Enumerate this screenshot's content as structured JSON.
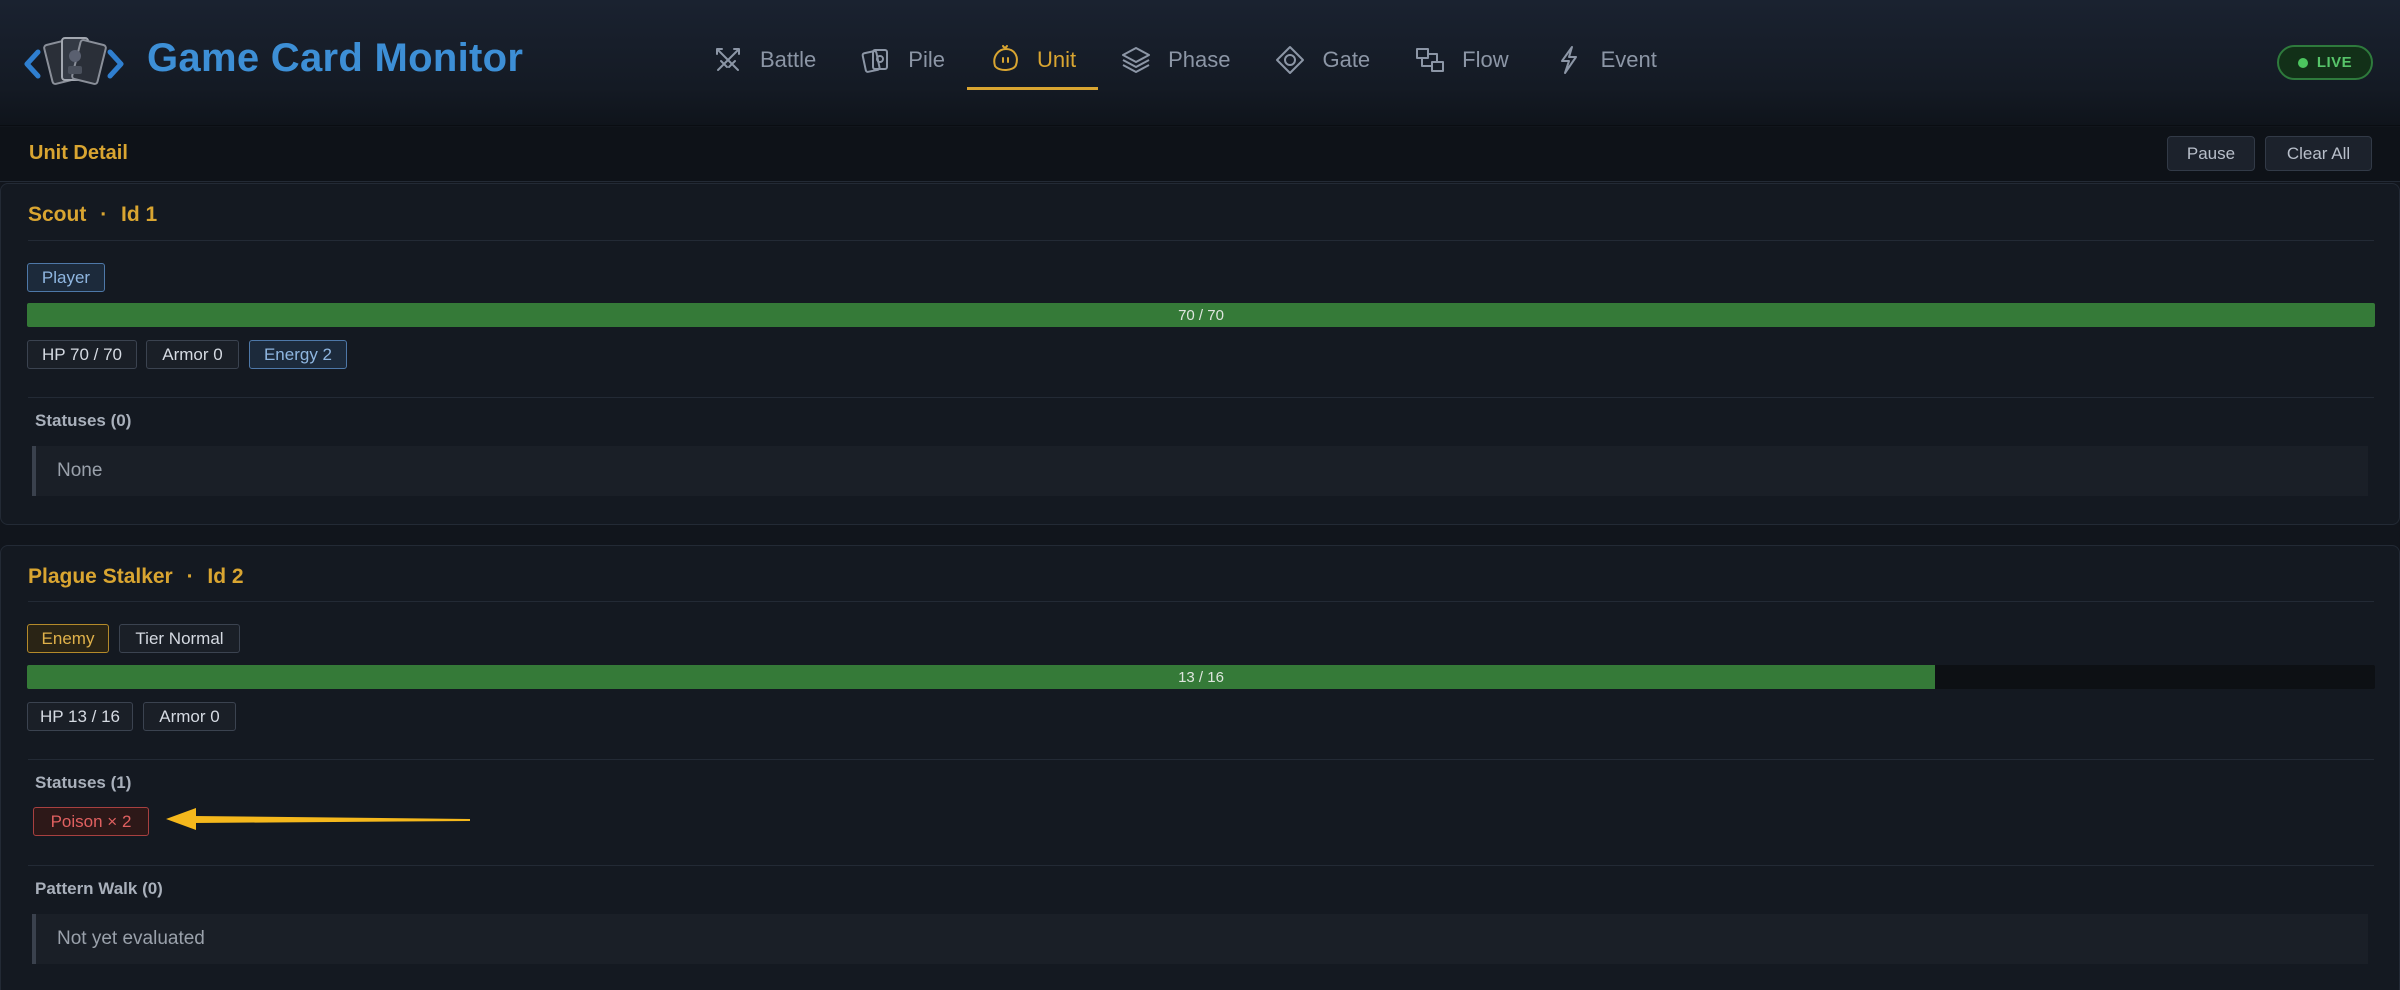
{
  "app": {
    "title": "Game Card Monitor",
    "live_label": "LIVE"
  },
  "nav": [
    {
      "label": "Battle",
      "icon": "swords-icon"
    },
    {
      "label": "Pile",
      "icon": "cards-icon"
    },
    {
      "label": "Unit",
      "icon": "creature-icon",
      "active": true
    },
    {
      "label": "Phase",
      "icon": "layers-icon"
    },
    {
      "label": "Gate",
      "icon": "diamond-icon"
    },
    {
      "label": "Flow",
      "icon": "flow-icon"
    },
    {
      "label": "Event",
      "icon": "bolt-icon"
    }
  ],
  "subbar": {
    "title": "Unit Detail",
    "pause_label": "Pause",
    "clear_label": "Clear All"
  },
  "units": [
    {
      "name": "Scout",
      "id_label": "Id 1",
      "separator": "·",
      "tags": [
        "Player"
      ],
      "hp_current": 70,
      "hp_max": 70,
      "hp_text": "70 / 70",
      "stats": [
        "HP 70 / 70",
        "Armor 0",
        "Energy 2"
      ],
      "statuses_label": "Statuses (0)",
      "statuses_empty": "None"
    },
    {
      "name": "Plague Stalker",
      "id_label": "Id 2",
      "separator": "·",
      "tags": [
        "Enemy",
        "Tier Normal"
      ],
      "hp_current": 13,
      "hp_max": 16,
      "hp_text": "13 / 16",
      "stats": [
        "HP 13 / 16",
        "Armor 0"
      ],
      "statuses_label": "Statuses (1)",
      "statuses": [
        "Poison  × 2"
      ],
      "pattern_label": "Pattern Walk (0)",
      "pattern_empty": "Not yet evaluated"
    }
  ],
  "colors": {
    "accent": "#d9a531",
    "brand": "#3d8fd6",
    "hp_fill": "#357a38",
    "live": "#4cc55f",
    "annotation_arrow": "#f5b81c"
  }
}
